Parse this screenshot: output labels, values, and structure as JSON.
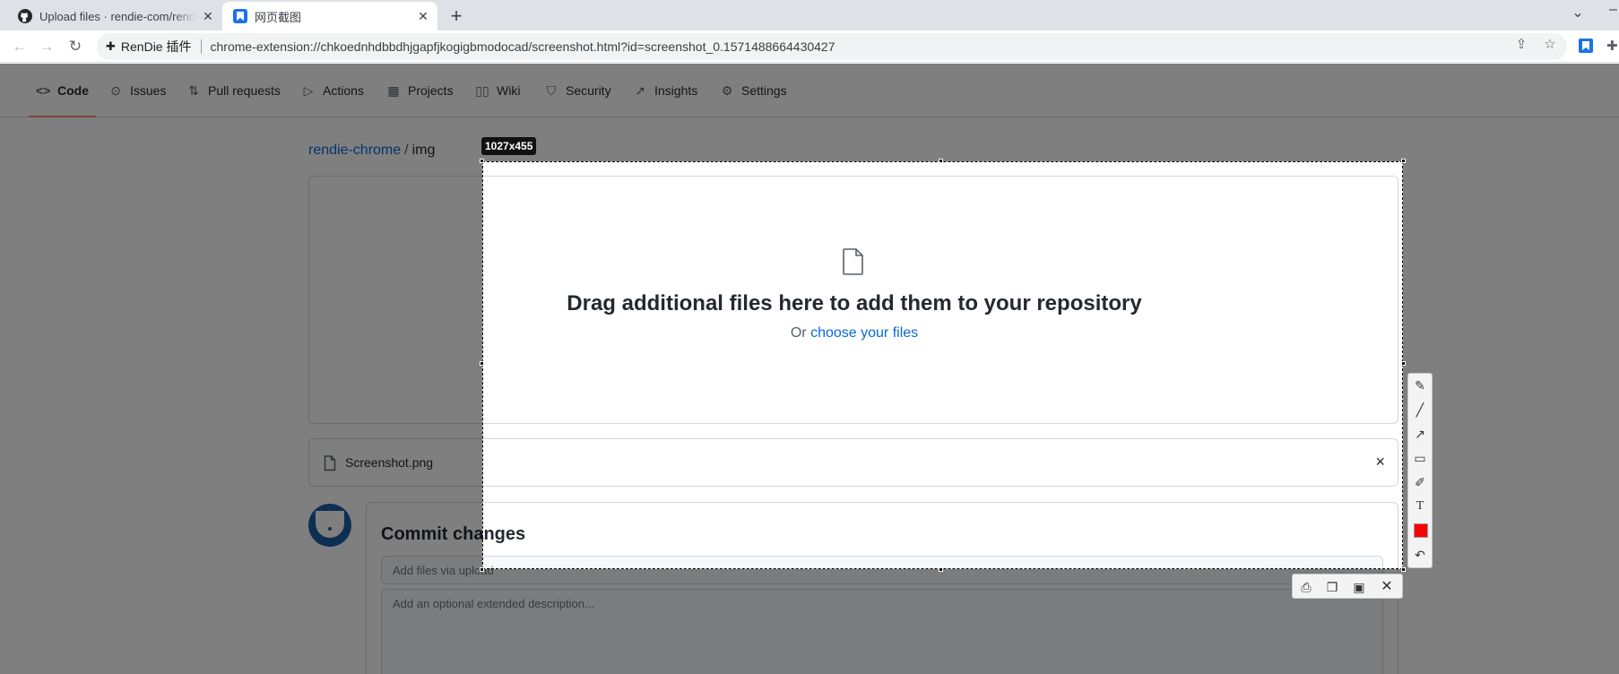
{
  "browser": {
    "tabs": [
      {
        "title": "Upload files · rendie-com/rendie-chrome",
        "active": false
      },
      {
        "title": "网页截图",
        "active": true
      }
    ],
    "new_tab": "+",
    "omnibox": {
      "extension_name": "RenDie 插件",
      "url": "chrome-extension://chkoednhdbbdhjgapfjkogigbmodocad/screenshot.html?id=screenshot_0.1571488664430427"
    }
  },
  "repo_nav": {
    "items": [
      {
        "label": "Code",
        "icon": "code-icon",
        "selected": true
      },
      {
        "label": "Issues",
        "icon": "issue-icon"
      },
      {
        "label": "Pull requests",
        "icon": "pull-request-icon"
      },
      {
        "label": "Actions",
        "icon": "play-icon"
      },
      {
        "label": "Projects",
        "icon": "table-icon"
      },
      {
        "label": "Wiki",
        "icon": "book-icon"
      },
      {
        "label": "Security",
        "icon": "shield-icon"
      },
      {
        "label": "Insights",
        "icon": "graph-icon"
      },
      {
        "label": "Settings",
        "icon": "gear-icon"
      }
    ]
  },
  "breadcrumb": {
    "owner": "rendie-chrome",
    "separator": "/",
    "path": "img"
  },
  "dropzone": {
    "title": "Drag additional files here to add them to your repository",
    "prefix": "Or",
    "link": "choose your files"
  },
  "file": {
    "name": "Screenshot.png",
    "remove": "×"
  },
  "commit": {
    "title": "Commit changes",
    "message_placeholder": "Add files via upload",
    "description_placeholder": "Add an optional extended description..."
  },
  "capture": {
    "size_label": "1027x455",
    "tools": [
      "pencil-icon",
      "line-icon",
      "arrow-icon",
      "rectangle-icon",
      "highlighter-icon",
      "text-icon",
      "color-swatch",
      "undo-icon"
    ],
    "color": "#ff0000",
    "actions": [
      "print-icon",
      "copy-icon",
      "save-icon",
      "close-icon"
    ]
  }
}
